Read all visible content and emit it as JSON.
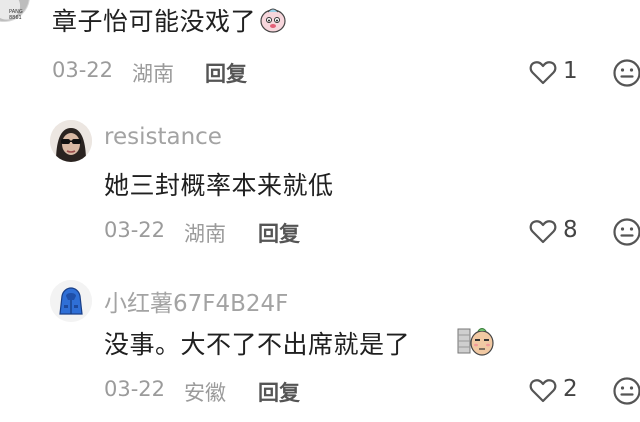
{
  "comments": [
    {
      "text": "章子怡可能没戏了",
      "date": "03-22",
      "location": "湖南",
      "reply_label": "回复",
      "likes": "1",
      "avatar_text": "PANG\n8861"
    },
    {
      "username": "resistance",
      "text": "她三封概率本来就低",
      "date": "03-22",
      "location": "湖南",
      "reply_label": "回复",
      "likes": "8"
    },
    {
      "username": "小红薯67F4B24F",
      "text": "没事。大不了不出席就是了",
      "date": "03-22",
      "location": "安徽",
      "reply_label": "回复",
      "likes": "2"
    }
  ],
  "colors": {
    "text": "#202020",
    "meta": "#9b9b9b",
    "username": "#a3a3a3",
    "icon": "#555555",
    "avatar_blue": "#2f6fd6"
  },
  "icons": [
    "heart-icon",
    "face-icon",
    "emoji-sticker",
    "jacket-avatar",
    "sunglasses-avatar"
  ]
}
